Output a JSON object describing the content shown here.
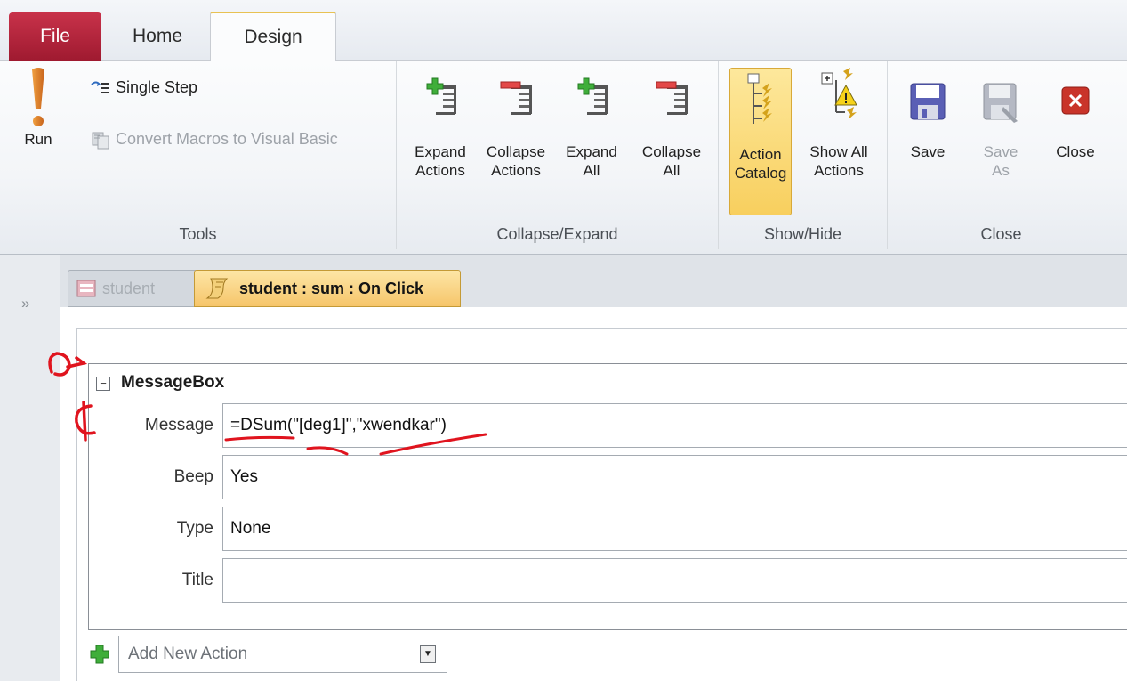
{
  "tabs": {
    "file": "File",
    "home": "Home",
    "design": "Design"
  },
  "ribbon": {
    "tools": {
      "label": "Tools",
      "run": "Run",
      "single_step": "Single Step",
      "convert_macros": "Convert Macros to Visual Basic"
    },
    "collapse_expand": {
      "label": "Collapse/Expand",
      "expand_actions": "Expand\nActions",
      "collapse_actions": "Collapse\nActions",
      "expand_all": "Expand\nAll",
      "collapse_all": "Collapse\nAll"
    },
    "show_hide": {
      "label": "Show/Hide",
      "action_catalog": "Action\nCatalog",
      "show_all_actions": "Show All\nActions"
    },
    "close": {
      "label": "Close",
      "save": "Save",
      "save_as": "Save\nAs",
      "close": "Close"
    }
  },
  "nav": {
    "toggle": "»"
  },
  "doc_tabs": [
    {
      "label": "student"
    },
    {
      "label": "student : sum : On Click",
      "active": true
    }
  ],
  "macro": {
    "action": "MessageBox",
    "args": [
      {
        "label": "Message",
        "value": "=DSum(\"[deg1]\",\"xwendkar\")"
      },
      {
        "label": "Beep",
        "value": "Yes"
      },
      {
        "label": "Type",
        "value": "None"
      },
      {
        "label": "Title",
        "value": ""
      }
    ],
    "add_new_action": "Add New Action"
  },
  "colors": {
    "file_tab": "#b42840",
    "active_doc_tab": "#f6c56a",
    "annotation": "#e0141e"
  }
}
